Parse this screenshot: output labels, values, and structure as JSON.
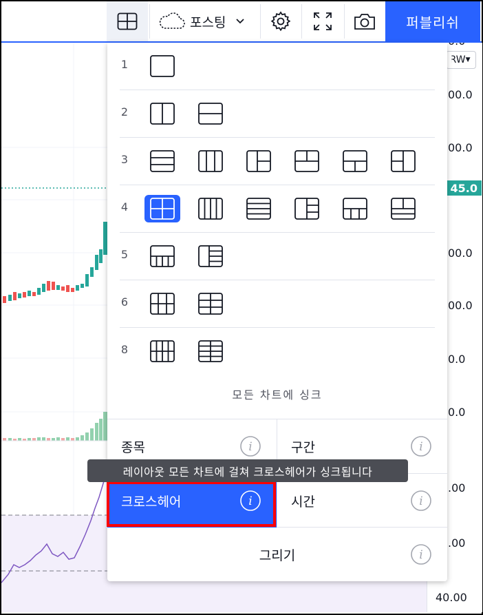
{
  "toolbar": {
    "cloud_label": "포스팅",
    "publish_label": "퍼블리쉬"
  },
  "price_axis": {
    "currency": "KRW",
    "labels": [
      "00.0",
      "00.0",
      "00.0",
      "00.0",
      "00.0",
      "0.0",
      "0.0",
      ".00",
      ".00",
      "40.00"
    ],
    "top_partial": "0.0",
    "current_price": "45.0"
  },
  "layout_menu": {
    "rows": [
      {
        "num": "1",
        "icons": [
          "single-pane-icon"
        ]
      },
      {
        "num": "2",
        "icons": [
          "two-vertical-icon",
          "two-horizontal-icon"
        ]
      },
      {
        "num": "3",
        "icons": [
          "three-rows-icon",
          "three-columns-icon",
          "one-left-two-right-icon",
          "two-top-one-bottom-icon",
          "one-top-two-bottom-icon",
          "two-left-one-right-icon"
        ]
      },
      {
        "num": "4",
        "icons": [
          "grid-2x2-icon",
          "four-columns-icon",
          "four-rows-icon",
          "one-left-three-right-icon",
          "one-top-three-bottom-icon",
          "three-top-one-bottom-icon"
        ]
      },
      {
        "num": "5",
        "icons": [
          "one-top-four-bottom-icon",
          "one-left-four-right-icon"
        ]
      },
      {
        "num": "6",
        "icons": [
          "grid-3x2-icon",
          "grid-2x3-icon"
        ]
      },
      {
        "num": "8",
        "icons": [
          "grid-4x2-icon",
          "grid-2x4-icon"
        ]
      }
    ],
    "selected_layout": "grid-2x2-icon"
  },
  "sync": {
    "title": "모든 차트에 싱크",
    "symbol": "종목",
    "interval": "구간",
    "crosshair": "크로스헤어",
    "time": "시간",
    "drawings": "그리기",
    "tooltip": "레이아웃 모든 차트에 걸쳐 크로스헤어가 싱크됩니다"
  },
  "colors": {
    "accent": "#2962ff",
    "up": "#26a69a",
    "down": "#ef5350",
    "highlight": "#ff0000"
  }
}
